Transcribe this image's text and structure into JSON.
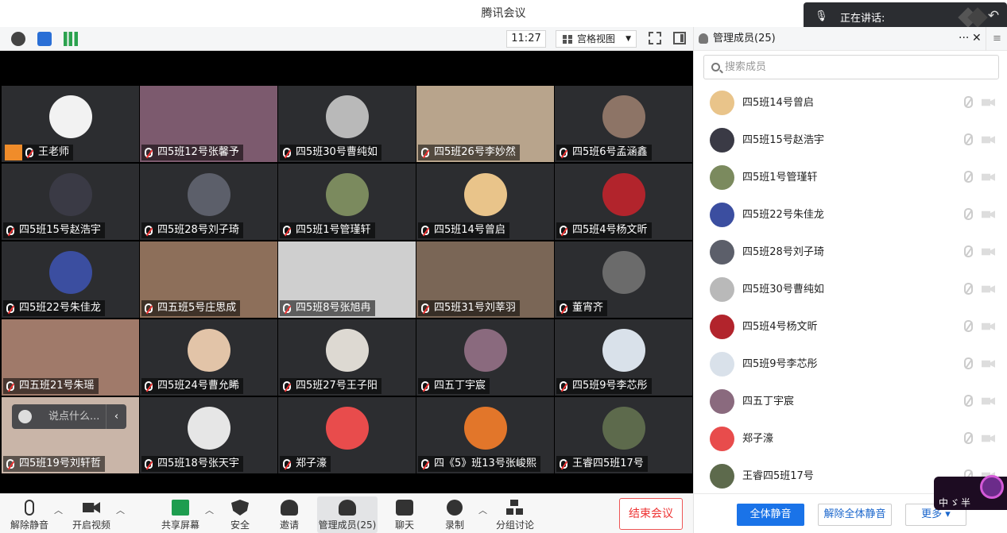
{
  "window": {
    "title": "腾讯会议"
  },
  "speaking": {
    "label": "正在讲话:"
  },
  "toolbar": {
    "time": "11:27",
    "view_mode": "宫格视图"
  },
  "chat": {
    "placeholder": "说点什么..."
  },
  "tiles": [
    {
      "name": "王老师",
      "host": true,
      "color": "#f2f2f2"
    },
    {
      "name": "四5班12号张馨予",
      "color": "#7c5a6e"
    },
    {
      "name": "四5班30号曹纯如",
      "color": "#b9b9b9"
    },
    {
      "name": "四5班26号李妙然",
      "color": "#b8a48c"
    },
    {
      "name": "四5班6号孟涵鑫",
      "color": "#8d7466"
    },
    {
      "name": "四5班15号赵浩宇",
      "color": "#3a3a45"
    },
    {
      "name": "四5班28号刘子琦",
      "color": "#5c5f6a"
    },
    {
      "name": "四5班1号管瑾轩",
      "color": "#7b8a5e"
    },
    {
      "name": "四5班14号曾启",
      "color": "#e9c48a"
    },
    {
      "name": "四5班4号杨文昕",
      "color": "#b2242c"
    },
    {
      "name": "四5班22号朱佳龙",
      "color": "#3b4ea0"
    },
    {
      "name": "四五班5号庄思成",
      "color": "#8d6f5a"
    },
    {
      "name": "四5班8号张旭冉",
      "color": "#cfcfcf"
    },
    {
      "name": "四5班31号刘莘羽",
      "color": "#7a6656"
    },
    {
      "name": "董宵齐",
      "color": "#6b6b6b"
    },
    {
      "name": "四五班21号朱瑶",
      "color": "#a07a6a"
    },
    {
      "name": "四5班24号曹允睎",
      "color": "#e2c4a8"
    },
    {
      "name": "四5班27号王子阳",
      "color": "#ddd9d2"
    },
    {
      "name": "四五丁宇宸",
      "color": "#8a6a7e"
    },
    {
      "name": "四5班9号李芯彤",
      "color": "#d9e1ea"
    },
    {
      "name": "四5班19号刘轩哲",
      "color": "#c9b5a8"
    },
    {
      "name": "四5班18号张天宇",
      "color": "#e6e6e6"
    },
    {
      "name": "郑子濠",
      "color": "#e84c4c"
    },
    {
      "name": "四《5》班13号张峻熙",
      "color": "#e2762a"
    },
    {
      "name": "王睿四5班17号",
      "color": "#5d6a4c"
    }
  ],
  "bottom": {
    "unmute": "解除静音",
    "video": "开启视频",
    "share": "共享屏幕",
    "security": "安全",
    "invite": "邀请",
    "members": "管理成员(25)",
    "chat": "聊天",
    "record": "录制",
    "breakout": "分组讨论",
    "end": "结束会议"
  },
  "sidebar": {
    "title": "管理成员(25)",
    "search_placeholder": "搜索成员",
    "members": [
      {
        "name": "四5班14号曾启",
        "color": "#e9c48a"
      },
      {
        "name": "四5班15号赵浩宇",
        "color": "#3a3a45"
      },
      {
        "name": "四5班1号管瑾轩",
        "color": "#7b8a5e"
      },
      {
        "name": "四5班22号朱佳龙",
        "color": "#3b4ea0"
      },
      {
        "name": "四5班28号刘子琦",
        "color": "#5c5f6a"
      },
      {
        "name": "四5班30号曹纯如",
        "color": "#b9b9b9"
      },
      {
        "name": "四5班4号杨文昕",
        "color": "#b2242c"
      },
      {
        "name": "四5班9号李芯彤",
        "color": "#d9e1ea"
      },
      {
        "name": "四五丁宇宸",
        "color": "#8a6a7e"
      },
      {
        "name": "郑子濠",
        "color": "#e84c4c"
      },
      {
        "name": "王睿四5班17号",
        "color": "#5d6a4c"
      }
    ],
    "mute_all": "全体静音",
    "unmute_all": "解除全体静音",
    "more": "更多 ▾"
  },
  "badge": {
    "text": "中ゞ半"
  }
}
